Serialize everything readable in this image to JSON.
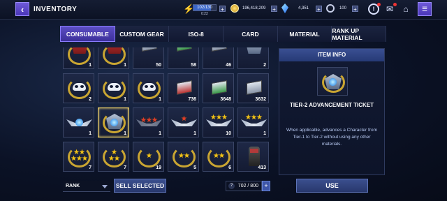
{
  "header": {
    "title": "INVENTORY",
    "energy": "102/130",
    "energy_ratio": 0.785,
    "energy_timer": "0:22",
    "gold": "196,418,209",
    "crystals": "4,351",
    "stamina": "100"
  },
  "tabs": [
    {
      "label": "CONSUMABLE",
      "active": true
    },
    {
      "label": "CUSTOM GEAR",
      "active": false
    },
    {
      "label": "ISO-8",
      "active": false
    },
    {
      "label": "CARD",
      "active": false
    },
    {
      "label": "MATERIAL",
      "active": false
    },
    {
      "label": "RANK UP MATERIAL",
      "active": false
    }
  ],
  "grid": {
    "rows": [
      [
        {
          "item": "rank-3-medal",
          "count": "1"
        },
        {
          "item": "rank-2-medal",
          "count": "1"
        },
        {
          "item": "card-stack",
          "count": "50"
        },
        {
          "item": "card-stack-green",
          "count": "58"
        },
        {
          "item": "card-stack-grey",
          "count": "46"
        },
        {
          "item": "star-badge",
          "count": "2"
        }
      ],
      [
        {
          "item": "mask-wreath",
          "count": "2"
        },
        {
          "item": "mask-wreath",
          "count": "1"
        },
        {
          "item": "mask-wreath",
          "count": "1"
        },
        {
          "item": "chip-red",
          "count": "736"
        },
        {
          "item": "chip-green",
          "count": "3648"
        },
        {
          "item": "chip-grey",
          "count": "3632"
        }
      ],
      [
        {
          "item": "winged-gem",
          "count": "1"
        },
        {
          "item": "wreath-gem",
          "count": "1",
          "selected": true
        },
        {
          "item": "red-stars",
          "count": "1"
        },
        {
          "item": "winged-red-star",
          "count": "1"
        },
        {
          "item": "winged-gold-stars",
          "count": "10"
        },
        {
          "item": "winged-gold-stars",
          "count": "1"
        }
      ],
      [
        {
          "item": "wreath-5-stars",
          "count": "7"
        },
        {
          "item": "wreath-3-stars",
          "count": "7"
        },
        {
          "item": "wreath-1-star",
          "count": "19"
        },
        {
          "item": "wreath-2-stars",
          "count": "5"
        },
        {
          "item": "wreath-2-stars-b",
          "count": "6"
        },
        {
          "item": "glove",
          "count": "413"
        }
      ]
    ]
  },
  "bottom": {
    "sort_label": "RANK",
    "sell_label": "SELL SELECTED",
    "capacity": "702 / 800",
    "capacity_icon": "?"
  },
  "panel": {
    "header": "ITEM INFO",
    "name": "TIER-2 ADVANCEMENT TICKET",
    "description": "When applicable, advances a Character from Tier-1 to Tier-2 without using any other materials.",
    "use_label": "USE"
  },
  "colors": {
    "accent": "#5c4ec4",
    "gold": "#f0c21a",
    "panel_header": "#3a4f92"
  }
}
